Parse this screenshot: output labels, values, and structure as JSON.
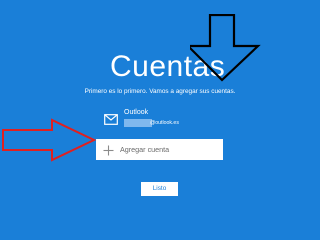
{
  "screen": {
    "title": "Cuentas",
    "subtitle": "Primero es lo primero. Vamos a agregar sus cuentas."
  },
  "account": {
    "provider": "Outlook",
    "email_suffix": "@outlook.es"
  },
  "actions": {
    "add_account_label": "Agregar cuenta",
    "done_label": "Listo"
  },
  "icons": {
    "mail": "mail-icon",
    "plus": "plus-icon"
  },
  "colors": {
    "background": "#1a7fd8",
    "button_bg": "#ffffff",
    "annotation_red": "#e02020",
    "annotation_black": "#000000"
  }
}
